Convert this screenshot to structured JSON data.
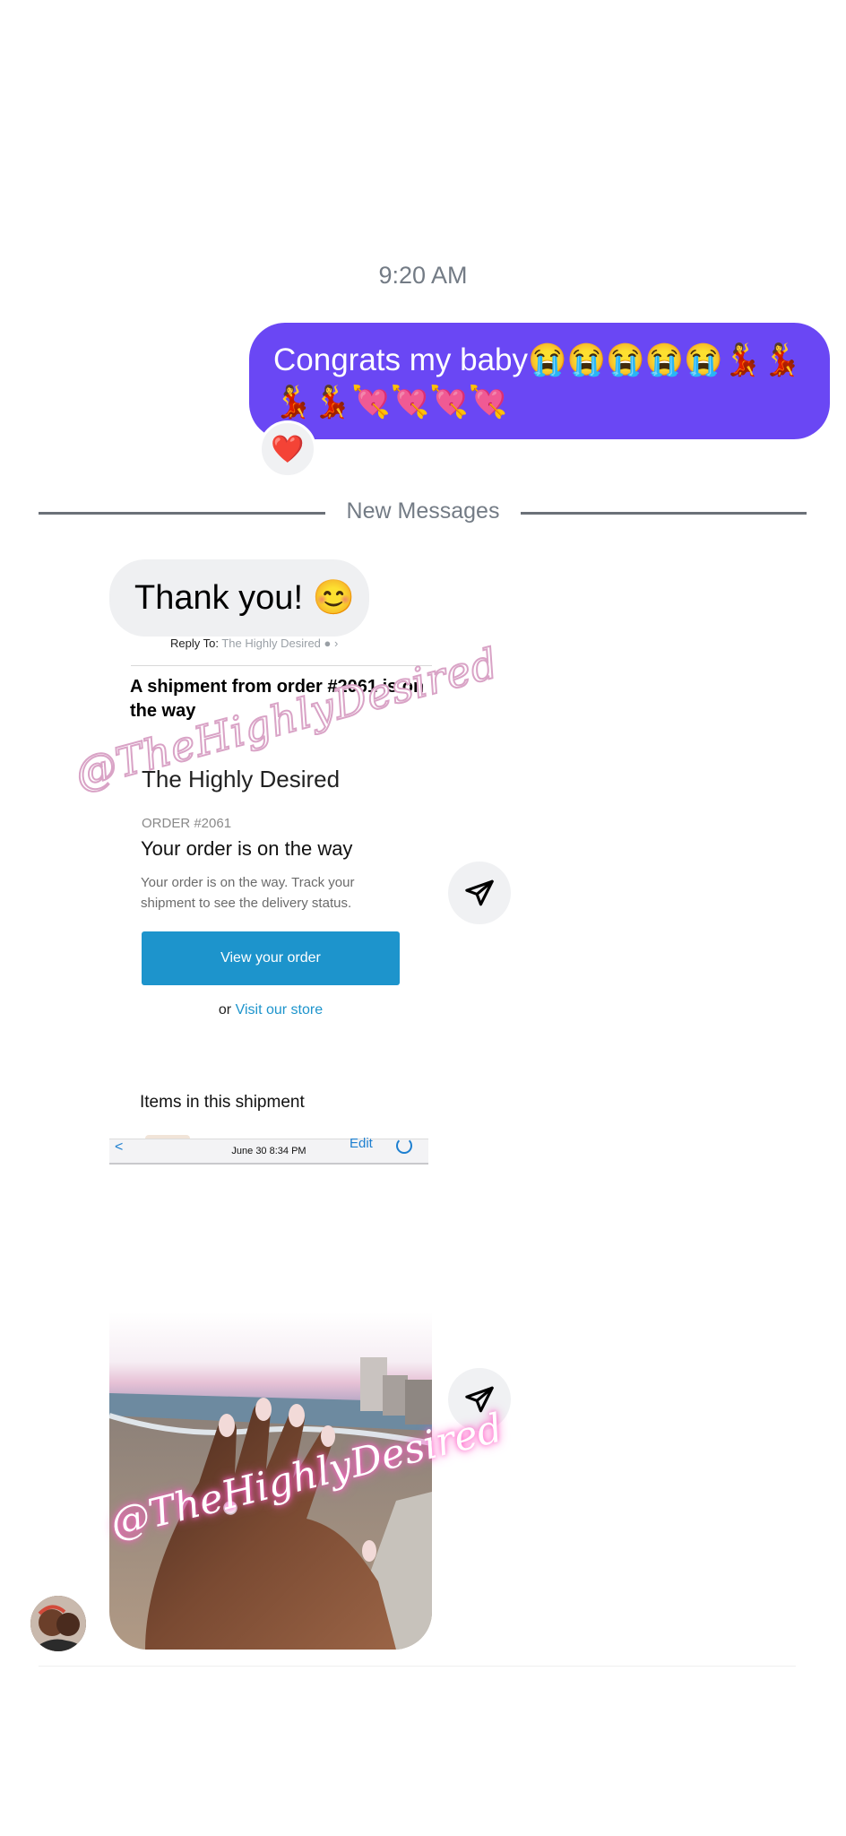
{
  "thread": {
    "timestamp": "9:20 AM",
    "divider_label": "New Messages"
  },
  "sent_message": {
    "text": "Congrats my baby😭😭😭😭😭💃💃💃💃💘💘💘💘",
    "bubble_color": "#6a47f4",
    "reaction": "❤️"
  },
  "received_message": {
    "text": "Thank you! 😊"
  },
  "email_screenshot": {
    "reply_to_label": "Reply To:",
    "reply_to_value": "The Highly Desired",
    "subject": "A shipment from order #2061 is on the way",
    "store_name": "The Highly Desired",
    "order_number": "ORDER #2061",
    "order_heading": "Your order is on the way",
    "order_description": "Your order is on the way. Track your shipment to see the delivery status.",
    "view_order_button": "View your order",
    "or_text": "or",
    "visit_store_link": "Visit our store",
    "items_heading": "Items in this shipment",
    "status_back": "<",
    "status_date": "June 30  8:34 PM",
    "status_edit": "Edit",
    "button_color": "#1d94cc"
  },
  "watermarks": {
    "first": "@TheHighlyDesired",
    "second": "@TheHighlyDesired"
  },
  "icons": {
    "share": "paper-plane-icon",
    "reaction": "heart-icon"
  }
}
